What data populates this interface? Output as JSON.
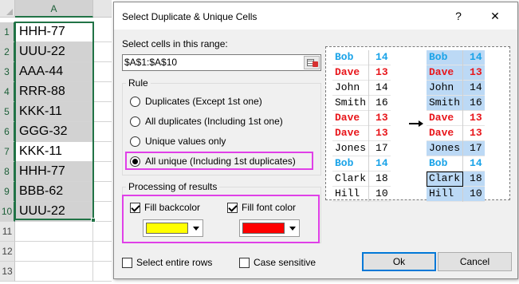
{
  "sheet": {
    "column_header": "A",
    "rows": [
      {
        "num": "1",
        "value": "HHH-77",
        "shaded": false
      },
      {
        "num": "2",
        "value": "UUU-22",
        "shaded": true
      },
      {
        "num": "3",
        "value": "AAA-44",
        "shaded": true
      },
      {
        "num": "4",
        "value": "RRR-88",
        "shaded": true
      },
      {
        "num": "5",
        "value": "KKK-11",
        "shaded": true
      },
      {
        "num": "6",
        "value": "GGG-32",
        "shaded": true
      },
      {
        "num": "7",
        "value": "KKK-11",
        "shaded": false
      },
      {
        "num": "8",
        "value": "HHH-77",
        "shaded": true
      },
      {
        "num": "9",
        "value": "BBB-62",
        "shaded": true
      },
      {
        "num": "10",
        "value": "UUU-22",
        "shaded": true
      }
    ],
    "empty_rows": [
      "11",
      "12",
      "13"
    ]
  },
  "dialog": {
    "title": "Select Duplicate & Unique Cells",
    "help": "?",
    "close": "✕",
    "range_label": "Select cells in this range:",
    "range_value": "$A$1:$A$10",
    "rule_label": "Rule",
    "rule_options": [
      {
        "label": "Duplicates (Except 1st one)",
        "selected": false
      },
      {
        "label": "All duplicates (Including 1st one)",
        "selected": false
      },
      {
        "label": "Unique values only",
        "selected": false
      },
      {
        "label": "All unique (Including 1st duplicates)",
        "selected": true
      }
    ],
    "processing_label": "Processing of results",
    "fill_backcolor_label": "Fill backcolor",
    "fill_backcolor_checked": true,
    "fill_backcolor_color": "#ffff00",
    "fill_font_label": "Fill font color",
    "fill_font_checked": true,
    "fill_font_color": "#ff0000",
    "select_entire_rows_label": "Select entire rows",
    "select_entire_rows_checked": false,
    "case_sensitive_label": "Case sensitive",
    "case_sensitive_checked": false,
    "ok_label": "Ok",
    "cancel_label": "Cancel",
    "highlight_color": "#e040e8"
  },
  "preview": {
    "before": [
      {
        "name": "Bob",
        "num": "14",
        "style": "blue"
      },
      {
        "name": "Dave",
        "num": "13",
        "style": "red"
      },
      {
        "name": "John",
        "num": "14",
        "style": "blk"
      },
      {
        "name": "Smith",
        "num": "16",
        "style": "blk"
      },
      {
        "name": "Dave",
        "num": "13",
        "style": "red"
      },
      {
        "name": "Dave",
        "num": "13",
        "style": "red"
      },
      {
        "name": "Jones",
        "num": "17",
        "style": "blk"
      },
      {
        "name": "Bob",
        "num": "14",
        "style": "blue"
      },
      {
        "name": "Clark",
        "num": "18",
        "style": "blk"
      },
      {
        "name": "Hill",
        "num": "10",
        "style": "blk"
      }
    ],
    "after": [
      {
        "name": "Bob",
        "num": "14",
        "style": "blue",
        "highlighted": true
      },
      {
        "name": "Dave",
        "num": "13",
        "style": "red",
        "highlighted": true
      },
      {
        "name": "John",
        "num": "14",
        "style": "blk",
        "highlighted": true
      },
      {
        "name": "Smith",
        "num": "16",
        "style": "blk",
        "highlighted": true
      },
      {
        "name": "Dave",
        "num": "13",
        "style": "red",
        "highlighted": false
      },
      {
        "name": "Dave",
        "num": "13",
        "style": "red",
        "highlighted": false
      },
      {
        "name": "Jones",
        "num": "17",
        "style": "blk",
        "highlighted": true
      },
      {
        "name": "Bob",
        "num": "14",
        "style": "blue",
        "highlighted": false
      },
      {
        "name": "Clark",
        "num": "18",
        "style": "blk",
        "highlighted": true
      },
      {
        "name": "Hill",
        "num": "10",
        "style": "blk",
        "highlighted": true
      }
    ]
  }
}
